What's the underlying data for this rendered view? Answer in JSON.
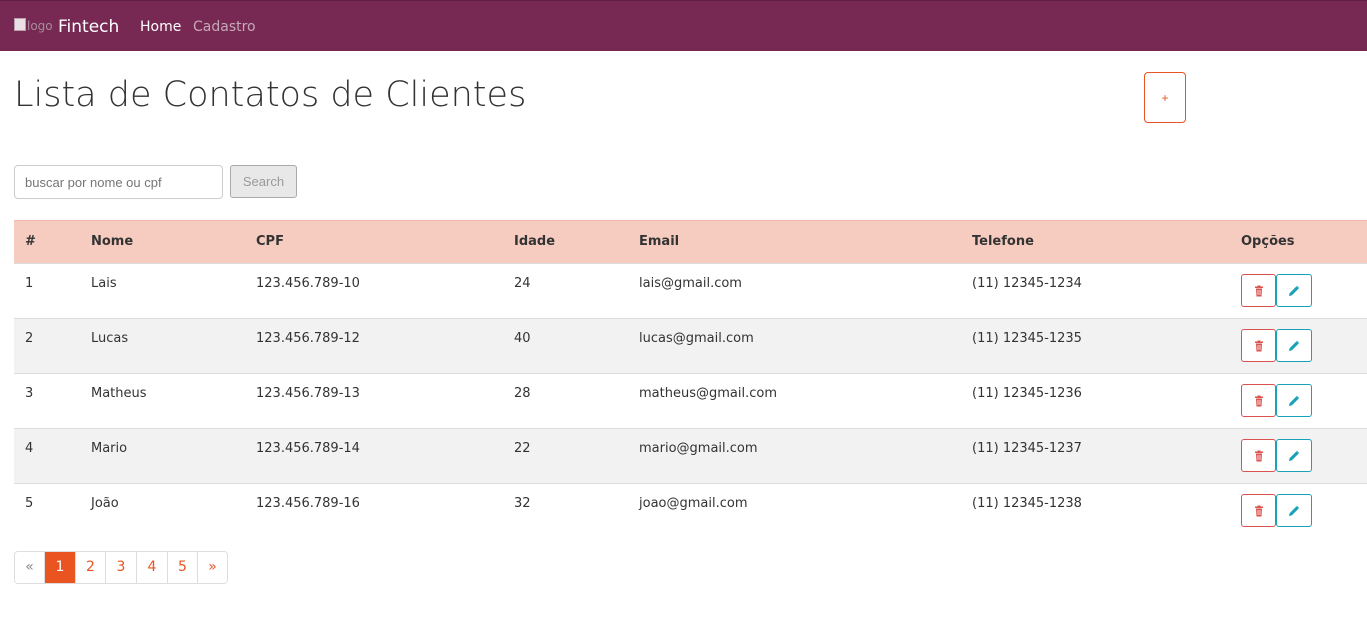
{
  "navbar": {
    "logo_alt": "logo",
    "brand": "Fintech",
    "links": [
      "Home",
      "Cadastro"
    ]
  },
  "page": {
    "title": "Lista de Contatos de Clientes",
    "add_label": "+"
  },
  "search": {
    "placeholder": "buscar por nome ou cpf",
    "button_label": "Search"
  },
  "table": {
    "headers": [
      "#",
      "Nome",
      "CPF",
      "Idade",
      "Email",
      "Telefone",
      "Opções"
    ],
    "rows": [
      [
        "1",
        "Lais",
        "123.456.789-10",
        "24",
        "lais@gmail.com",
        "(11) 12345-1234"
      ],
      [
        "2",
        "Lucas",
        "123.456.789-12",
        "40",
        "lucas@gmail.com",
        "(11) 12345-1235"
      ],
      [
        "3",
        "Matheus",
        "123.456.789-13",
        "28",
        "matheus@gmail.com",
        "(11) 12345-1236"
      ],
      [
        "4",
        "Mario",
        "123.456.789-14",
        "22",
        "mario@gmail.com",
        "(11) 12345-1237"
      ],
      [
        "5",
        "João",
        "123.456.789-16",
        "32",
        "joao@gmail.com",
        "(11) 12345-1238"
      ]
    ],
    "row_actions": {
      "delete_icon": "trash-icon",
      "edit_icon": "pencil-icon"
    }
  },
  "pagination": {
    "prev": "«",
    "pages": [
      "1",
      "2",
      "3",
      "4",
      "5"
    ],
    "next": "»",
    "active_page": "1"
  },
  "colors": {
    "navbar": "#772953",
    "accent": "#e95420",
    "header_row": "#f7ccc0",
    "danger": "#d9534f",
    "info": "#17a2b8"
  }
}
